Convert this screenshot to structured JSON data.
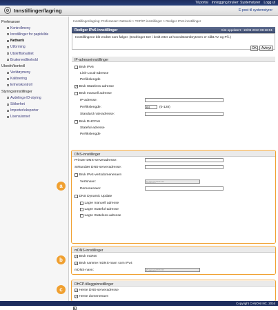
{
  "topbar": {
    "portal": "Til portal",
    "login": "Innlogging bruker: Systemstyrer",
    "logout": "Logg ut"
  },
  "titlebar": {
    "title": "Innstillinger/lagring",
    "email": "E-post til systemstyrer"
  },
  "sidebar": {
    "groups": [
      {
        "label": "Preferanser",
        "items": [
          "Kontrollmeny",
          "Innstillinger for papirkilde",
          "Nettverk",
          "Utforming",
          "Utskriftskvalitet",
          "Brukervedlikehold"
        ]
      },
      {
        "label": "Ukesfri/kontroll",
        "items": [
          "Verktøymeny",
          "Kalibrering",
          "Enhetskontroll"
        ]
      },
      {
        "label": "Styringsinnstillinger",
        "items": [
          "Avdelings-ID-styring",
          "Sikkerhet",
          "Importer/eksporter",
          "Lisens/annet"
        ]
      }
    ],
    "active": "Nettverk"
  },
  "breadcrumb": "Innstillinger/lagring: Preferanser: Nettverk > TCP/IP-innstillinger > Rediger IPv6-innstillinger",
  "header": {
    "title": "Rediger IPv6-innstillinger",
    "last_updated": "Sist oppdatert : 19/06 2010 08:16:51"
  },
  "notice": "Innstillingene blir endret som følger. (Endringer trer i kraft etter at hovedstrømbryteren er slått AV og PÅ.)",
  "buttons": {
    "ok": "OK",
    "cancel": "Avbryt"
  },
  "ipaddr": {
    "title": "IP-adresseinnstillinger",
    "use_ipv6": "Bruk IPv6",
    "link_local": "Link-Local-adresse",
    "prefix_len": "Prefikslengde",
    "stateless": "Bruk Stateless-adresse",
    "manual": "Bruk manuell adresse",
    "ip_addr": "IP-adresse:",
    "prefix_len2": "Prefikslengde:",
    "prefix_value": "64",
    "prefix_range": "(0-128)",
    "router": "Standard ruteradresse:",
    "dhcp": "Bruk DHCPv6",
    "stateful": "Stateful-adresse",
    "prefix_len3": "Prefikslengde"
  },
  "dns": {
    "title": "DNS-innstillinger",
    "primary": "Primær DNS-serveradresse:",
    "secondary": "Sekundær DNS-serveradresse:",
    "use_ipv4": "Bruk IPv4-vertsdomenenavn",
    "host": "Vertsnavn:",
    "host_value": "Canon*******",
    "domain": "Domenenavn:",
    "dyn_update": "DNS Dynamic Update",
    "reg_manual": "Lagre manuell adresse",
    "reg_stateful": "Lagre Stateful-adresse",
    "reg_stateless": "Lagre Stateless-adresse"
  },
  "mdns": {
    "title": "mDNS-innstillinger",
    "use": "Bruk mDNS",
    "same": "Bruk samme mDNS-navn som IPv4",
    "name": "mDNS-navn:",
    "name_value": "Canon*******"
  },
  "dhcp_opt": {
    "title": "DHCP-tilleggsinnstillinger",
    "dns_addr": "Hente DNS-serveradresse",
    "domain": "Hente domenenavn"
  },
  "markers": {
    "a": "a",
    "b": "b",
    "c": "c"
  },
  "footer": "Copyright CANON INC. 2016",
  "colors": {
    "accent": "#f0a030",
    "header": "#1d2d5e"
  }
}
